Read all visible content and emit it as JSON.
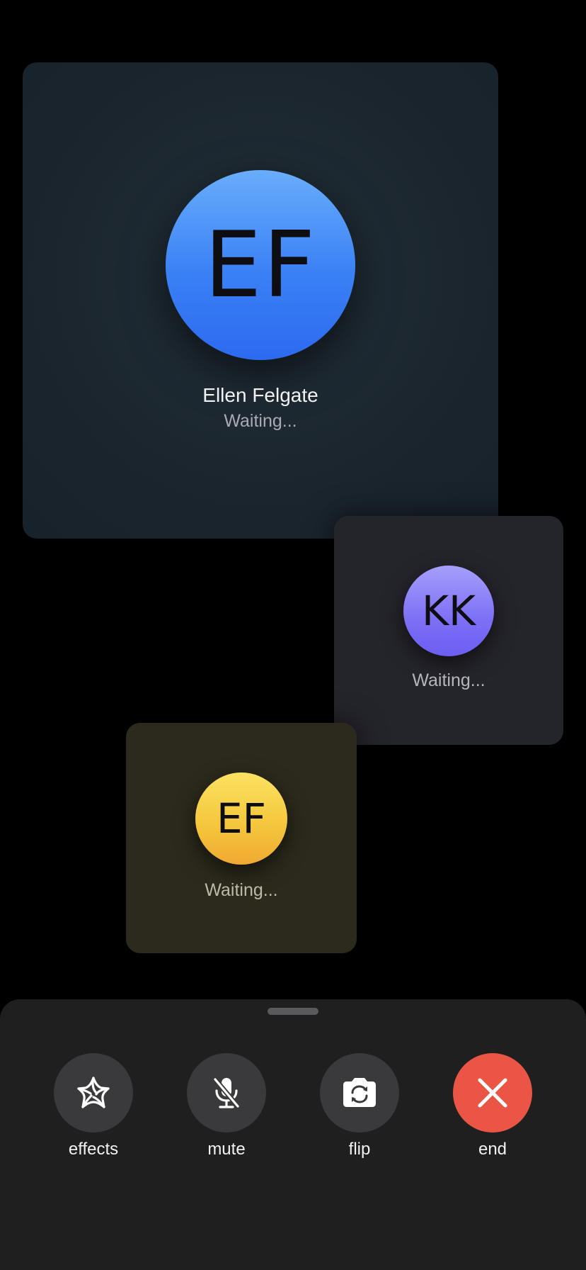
{
  "participants": {
    "main": {
      "initials": "EF",
      "name": "Ellen Felgate",
      "status": "Waiting..."
    },
    "second": {
      "initials": "KK",
      "status": "Waiting..."
    },
    "third": {
      "initials": "EF",
      "status": "Waiting..."
    }
  },
  "controls": {
    "effects": {
      "label": "effects",
      "icon": "effects-star-icon"
    },
    "mute": {
      "label": "mute",
      "icon": "mic-slash-icon"
    },
    "flip": {
      "label": "flip",
      "icon": "camera-flip-icon"
    },
    "end": {
      "label": "end",
      "icon": "close-icon"
    }
  },
  "colors": {
    "end_button": "#eb5545",
    "main_avatar": "#3a80f5",
    "second_avatar": "#7d6ff5",
    "third_avatar": "#f4c53a",
    "control_button": "#3a3a3c"
  }
}
